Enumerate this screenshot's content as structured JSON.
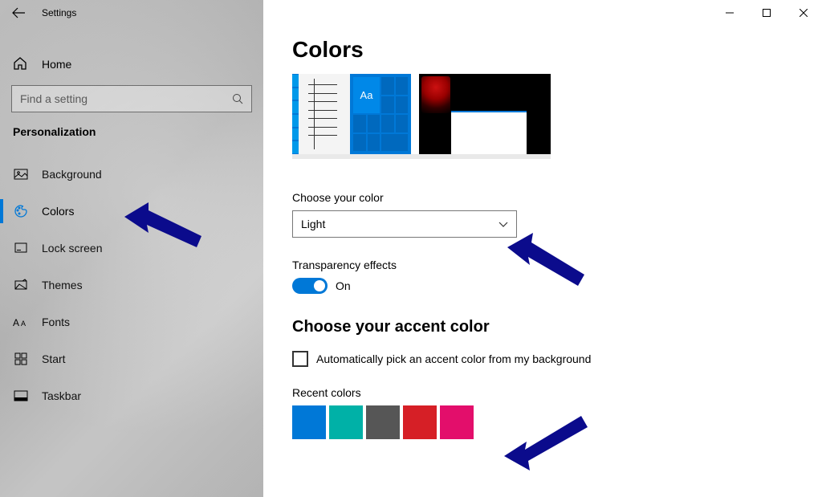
{
  "window": {
    "title": "Settings"
  },
  "sidebar": {
    "home_label": "Home",
    "search": {
      "placeholder": "Find a setting"
    },
    "section_title": "Personalization",
    "items": [
      {
        "label": "Background",
        "icon": "picture-icon"
      },
      {
        "label": "Colors",
        "icon": "palette-icon"
      },
      {
        "label": "Lock screen",
        "icon": "lockscreen-icon"
      },
      {
        "label": "Themes",
        "icon": "themes-icon"
      },
      {
        "label": "Fonts",
        "icon": "fonts-icon"
      },
      {
        "label": "Start",
        "icon": "start-icon"
      },
      {
        "label": "Taskbar",
        "icon": "taskbar-icon"
      }
    ],
    "selected_index": 1
  },
  "main": {
    "title": "Colors",
    "choose_color_label": "Choose your color",
    "color_mode_value": "Light",
    "transparency_label": "Transparency effects",
    "transparency_state": "On",
    "accent_title": "Choose your accent color",
    "auto_accent_label": "Automatically pick an accent color from my background",
    "auto_accent_checked": false,
    "recent_label": "Recent colors",
    "recent_colors": [
      "#0078d7",
      "#00b1a7",
      "#565656",
      "#d61f26",
      "#e30e6b"
    ],
    "preview_tile_text": "Aa"
  },
  "annotations": {
    "arrow_color": "#0b0b8c",
    "arrows": [
      "points-to-colors-nav",
      "points-to-color-select",
      "points-to-recent-colors"
    ]
  }
}
